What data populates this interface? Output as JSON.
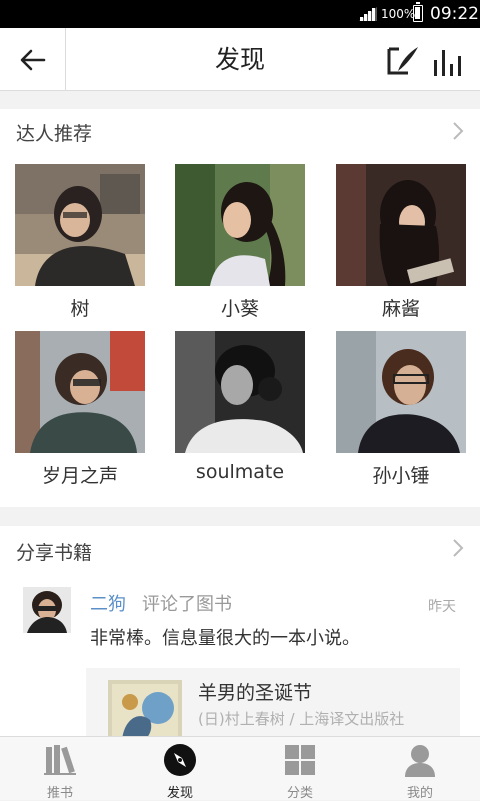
{
  "status_bar": {
    "battery": "100%",
    "time": "09:22"
  },
  "header": {
    "title": "发现"
  },
  "experts": {
    "title": "达人推荐",
    "people": [
      {
        "name": "树"
      },
      {
        "name": "小葵"
      },
      {
        "name": "麻酱"
      },
      {
        "name": "岁月之声"
      },
      {
        "name": "soulmate"
      },
      {
        "name": "孙小锤"
      }
    ]
  },
  "books": {
    "title": "分享书籍",
    "post": {
      "user": "二狗",
      "action": "评论了图书",
      "time": "昨天",
      "comment": "非常棒。信息量很大的一本小说。",
      "book_title": "羊男的圣诞节",
      "book_meta": "(日)村上春树 / 上海译文出版社"
    }
  },
  "nav": [
    {
      "label": "推书",
      "icon": "books-icon"
    },
    {
      "label": "发现",
      "icon": "compass-icon",
      "active": true
    },
    {
      "label": "分类",
      "icon": "grid-icon"
    },
    {
      "label": "我的",
      "icon": "user-icon"
    }
  ],
  "colors": {
    "link": "#5b8fc7",
    "background": "#f2f2f2"
  }
}
